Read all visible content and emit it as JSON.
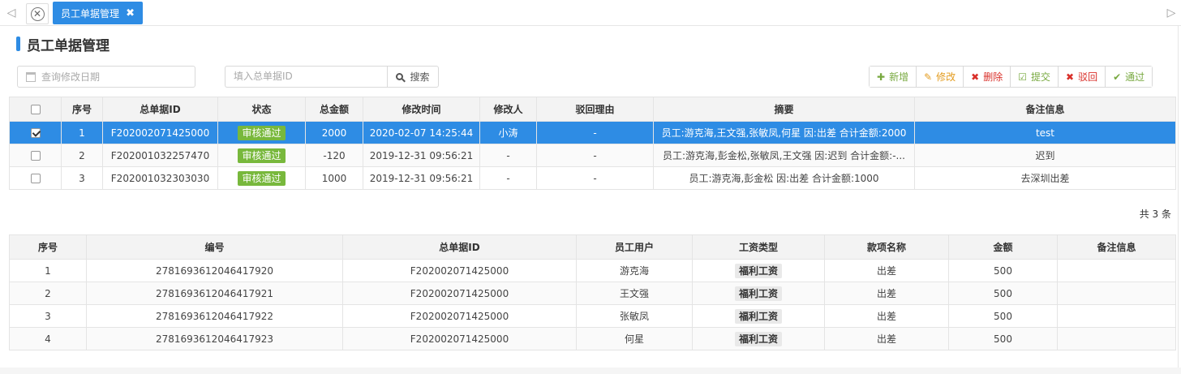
{
  "tabs": {
    "active_label": "员工单据管理",
    "close_glyph": "✖"
  },
  "page": {
    "title": "员工单据管理"
  },
  "toolbar": {
    "date_placeholder": "查询修改日期",
    "search_placeholder": "填入总单据ID",
    "search_label": "搜索",
    "buttons": [
      {
        "label": "新增",
        "icon": "plus-icon",
        "glyph": "✚",
        "color": "#78a940"
      },
      {
        "label": "修改",
        "icon": "edit-icon",
        "glyph": "✎",
        "color": "#e39c1f"
      },
      {
        "label": "删除",
        "icon": "close-icon",
        "glyph": "✖",
        "color": "#d9302a"
      },
      {
        "label": "提交",
        "icon": "check-square-icon",
        "glyph": "☑",
        "color": "#78a940"
      },
      {
        "label": "驳回",
        "icon": "close-icon",
        "glyph": "✖",
        "color": "#d9302a"
      },
      {
        "label": "通过",
        "icon": "check-icon",
        "glyph": "✔",
        "color": "#78a940"
      }
    ]
  },
  "master_table": {
    "headers": [
      "序号",
      "总单据ID",
      "状态",
      "总金额",
      "修改时间",
      "修改人",
      "驳回理由",
      "摘要",
      "备注信息"
    ],
    "rows": [
      {
        "selected": true,
        "no": "1",
        "id": "F202002071425000",
        "status": "审核通过",
        "amount": "2000",
        "time": "2020-02-07 14:25:44",
        "editor": "小涛",
        "reject": "-",
        "summary": "员工:游克海,王文强,张敏凤,何星 因:出差 合计金额:2000",
        "remark": "test"
      },
      {
        "selected": false,
        "no": "2",
        "id": "F202001032257470",
        "status": "审核通过",
        "amount": "-120",
        "time": "2019-12-31 09:56:21",
        "editor": "-",
        "reject": "-",
        "summary": "员工:游克海,彭金松,张敏凤,王文强 因:迟到 合计金额:-...",
        "remark": "迟到"
      },
      {
        "selected": false,
        "no": "3",
        "id": "F202001032303030",
        "status": "审核通过",
        "amount": "1000",
        "time": "2019-12-31 09:56:21",
        "editor": "-",
        "reject": "-",
        "summary": "员工:游克海,彭金松 因:出差 合计金额:1000",
        "remark": "去深圳出差"
      }
    ],
    "total_text": "共 3 条"
  },
  "detail_table": {
    "headers": [
      "序号",
      "编号",
      "总单据ID",
      "员工用户",
      "工资类型",
      "款项名称",
      "金额",
      "备注信息"
    ],
    "rows": [
      {
        "no": "1",
        "code": "2781693612046417920",
        "id": "F202002071425000",
        "user": "游克海",
        "type": "福利工资",
        "item": "出差",
        "amount": "500",
        "remark": ""
      },
      {
        "no": "2",
        "code": "2781693612046417921",
        "id": "F202002071425000",
        "user": "王文强",
        "type": "福利工资",
        "item": "出差",
        "amount": "500",
        "remark": ""
      },
      {
        "no": "3",
        "code": "2781693612046417922",
        "id": "F202002071425000",
        "user": "张敏凤",
        "type": "福利工资",
        "item": "出差",
        "amount": "500",
        "remark": ""
      },
      {
        "no": "4",
        "code": "2781693612046417923",
        "id": "F202002071425000",
        "user": "何星",
        "type": "福利工资",
        "item": "出差",
        "amount": "500",
        "remark": ""
      }
    ]
  },
  "colors": {
    "accent": "#2e8ce4",
    "success_badge": "#78b83c"
  }
}
